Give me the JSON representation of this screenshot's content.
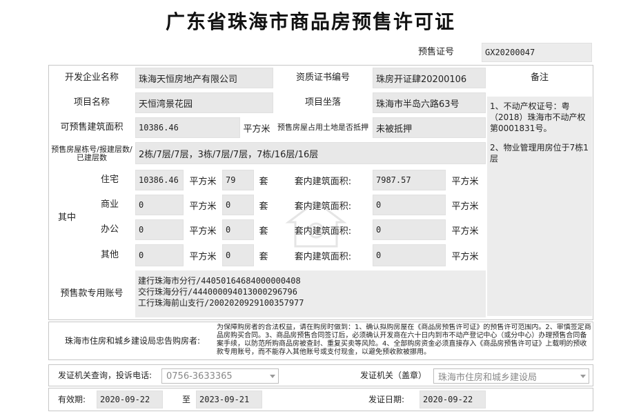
{
  "doc": {
    "title": "广东省珠海市商品房预售许可证",
    "cert_no_label": "预售证号",
    "cert_no": "GX20200047"
  },
  "labels": {
    "developer": "开发企业名称",
    "qual_no": "资质证书编号",
    "remarks": "备注",
    "project_name": "项目名称",
    "location": "项目坐落",
    "area": "可预售建筑面积",
    "sqm": "平方米",
    "mortgage": "预售房屋占用土地是否抵押",
    "buildings": "预售房屋栋号/报建层数/已建层数",
    "among": "其中",
    "residential": "住宅",
    "commercial": "商业",
    "office": "办公",
    "other": "其他",
    "sets": "套",
    "inner_area": "套内建筑面积:",
    "account": "预售款专用账号",
    "bureau_notice": "珠海市住房和城乡建设局忠告购房者:",
    "phone": "发证机关查询，投诉电话:",
    "issuer": "发证机关（盖章）",
    "valid": "有效期:",
    "to": "至",
    "issue_date": "发证日期:"
  },
  "values": {
    "developer": "珠海天恒房地产有限公司",
    "qual_no": "珠房开证肆20200106",
    "project_name": "天恒湾景花园",
    "location": "珠海市半岛六路63号",
    "area": "10386.46",
    "mortgage": "未被抵押",
    "buildings": "2栋/7层/7层，3栋/7层/7层，7栋/16层/16层",
    "remarks_1": "1、不动产权证号：粤（2018）珠海市不动产权第0001831号。",
    "remarks_2": "2、物业管理用房位于7栋1层",
    "residential_area": "10386.46",
    "residential_sets": "79",
    "residential_inner": "7987.57",
    "commercial_area": "0",
    "commercial_sets": "0",
    "commercial_inner": "0",
    "office_area": "0",
    "office_sets": "0",
    "office_inner": "0",
    "other_area": "0",
    "other_sets": "0",
    "other_inner": "0",
    "account_1": "建行珠海市分行/44050164684000000408",
    "account_2": "交行珠海分行/444000094013000296796",
    "account_3": "工行珠海前山支行/2002020929100357977",
    "notice": "为保障购房者的合法权益，请在购房时做到：1、确认拟购房屋在《商品房预售许可证》的预售许可范围内。2、审慎签定商品房购买合同。3、商品房预售合同签订后，必须确认开发商在六十日内到市不动产登记中心（或分中心）办理预售合同备案手续，以防范所购商品房被查封、重复买卖等风险。4、全部购房资金必须直接存入《商品房预售许可证》上载明的预收款专用账号，而不能存入其他账号或支付现金，以避免预收款被挪用。",
    "phone": "0756-3633365",
    "issuer": "珠海市住房和城乡建设局",
    "valid_from": "2020-09-22",
    "valid_to": "2023-09-21",
    "issue_date": "2020-09-22"
  }
}
